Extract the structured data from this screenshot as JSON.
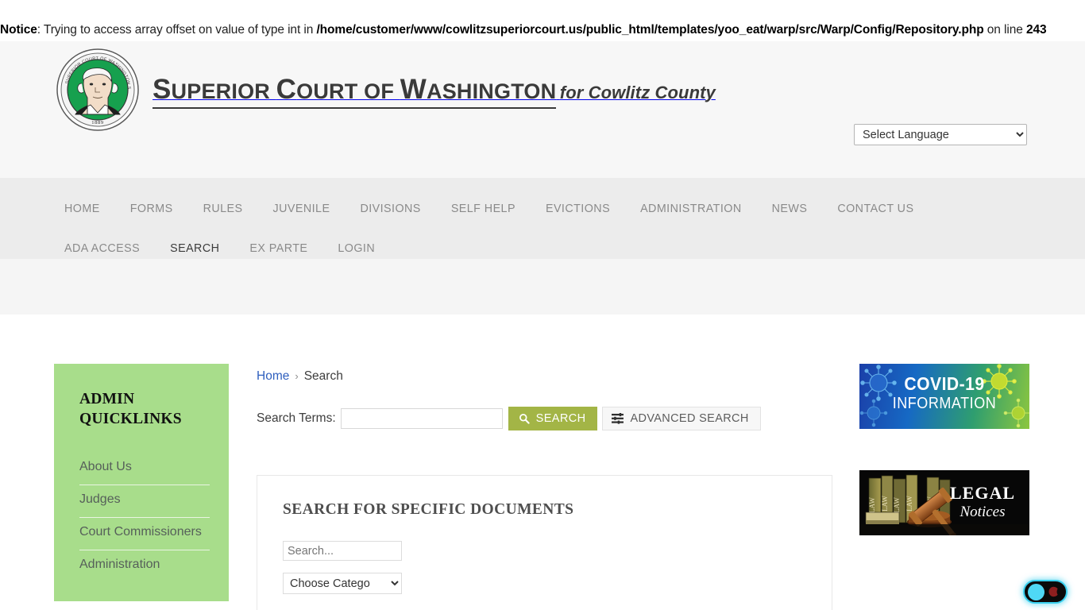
{
  "php_notice": {
    "label": "Notice",
    "message": ": Trying to access array offset on value of type int in ",
    "path": "/home/customer/www/cowlitzsuperiorcourt.us/public_html/templates/yoo_eat/warp/src/Warp/Config/Repository.php",
    "tail": " on line ",
    "line": "243"
  },
  "header": {
    "logo_line1": "UPERIOR",
    "logo_line1_b": "OURT OF ",
    "logo_line1_c": "ASHINGTON",
    "logo_line2": "for Cowlitz County",
    "seal_alt": "washington-state-seal",
    "seal_rim_text": "SUPERIOR COURT OF WASHINGTON STATE FOR COWLITZ COUNTY",
    "seal_year": "1889",
    "language_selector": {
      "selected": "Select Language",
      "options": [
        "Select Language"
      ]
    }
  },
  "nav": {
    "items": [
      {
        "label": "HOME",
        "active": false
      },
      {
        "label": "FORMS",
        "active": false
      },
      {
        "label": "RULES",
        "active": false
      },
      {
        "label": "JUVENILE",
        "active": false
      },
      {
        "label": "DIVISIONS",
        "active": false
      },
      {
        "label": "SELF HELP",
        "active": false
      },
      {
        "label": "EVICTIONS",
        "active": false
      },
      {
        "label": "ADMINISTRATION",
        "active": false
      },
      {
        "label": "NEWS",
        "active": false
      },
      {
        "label": "CONTACT US",
        "active": false
      },
      {
        "label": "ADA ACCESS",
        "active": false
      },
      {
        "label": "SEARCH",
        "active": true
      },
      {
        "label": "EX PARTE",
        "active": false
      },
      {
        "label": "LOGIN",
        "active": false
      }
    ]
  },
  "sidebar": {
    "title_line1": "ADMIN",
    "title_line2": "QUICKLINKS",
    "items": [
      {
        "label": "About Us"
      },
      {
        "label": "Judges"
      },
      {
        "label": "Court Commissioners"
      },
      {
        "label": "Administration"
      }
    ]
  },
  "breadcrumb": {
    "home": "Home",
    "separator": "›",
    "current": "Search"
  },
  "search": {
    "terms_label": "Search Terms:",
    "terms_value": "",
    "terms_placeholder": "",
    "search_button": "SEARCH",
    "search_icon": "search-icon",
    "advanced_button": "ADVANCED SEARCH",
    "advanced_icon": "sliders-icon"
  },
  "documents_panel": {
    "title": "SEARCH FOR SPECIFIC DOCUMENTS",
    "search_placeholder": "Search...",
    "search_value": "",
    "category_selected": "Choose Catego",
    "category_options": [
      "Choose Catego"
    ]
  },
  "banners": [
    {
      "name": "covid-19-information",
      "line1": "COVID-19",
      "line2": "INFORMATION"
    },
    {
      "name": "legal-notices",
      "line1": "LEGAL",
      "line2": "Notices"
    }
  ],
  "dark_mode_toggle": {
    "name": "dark-mode-toggle",
    "state": "light",
    "sun_icon": "sun-circle-icon",
    "moon_icon": "moon-icon"
  },
  "colors": {
    "accent_green": "#a3b546",
    "sidebar_green": "#a8dd8b",
    "nav_bg": "#ececec",
    "header_bg": "#f7f7f7",
    "link_blue": "#2f5fbe",
    "toggle_cyan": "#4fd8f5"
  }
}
